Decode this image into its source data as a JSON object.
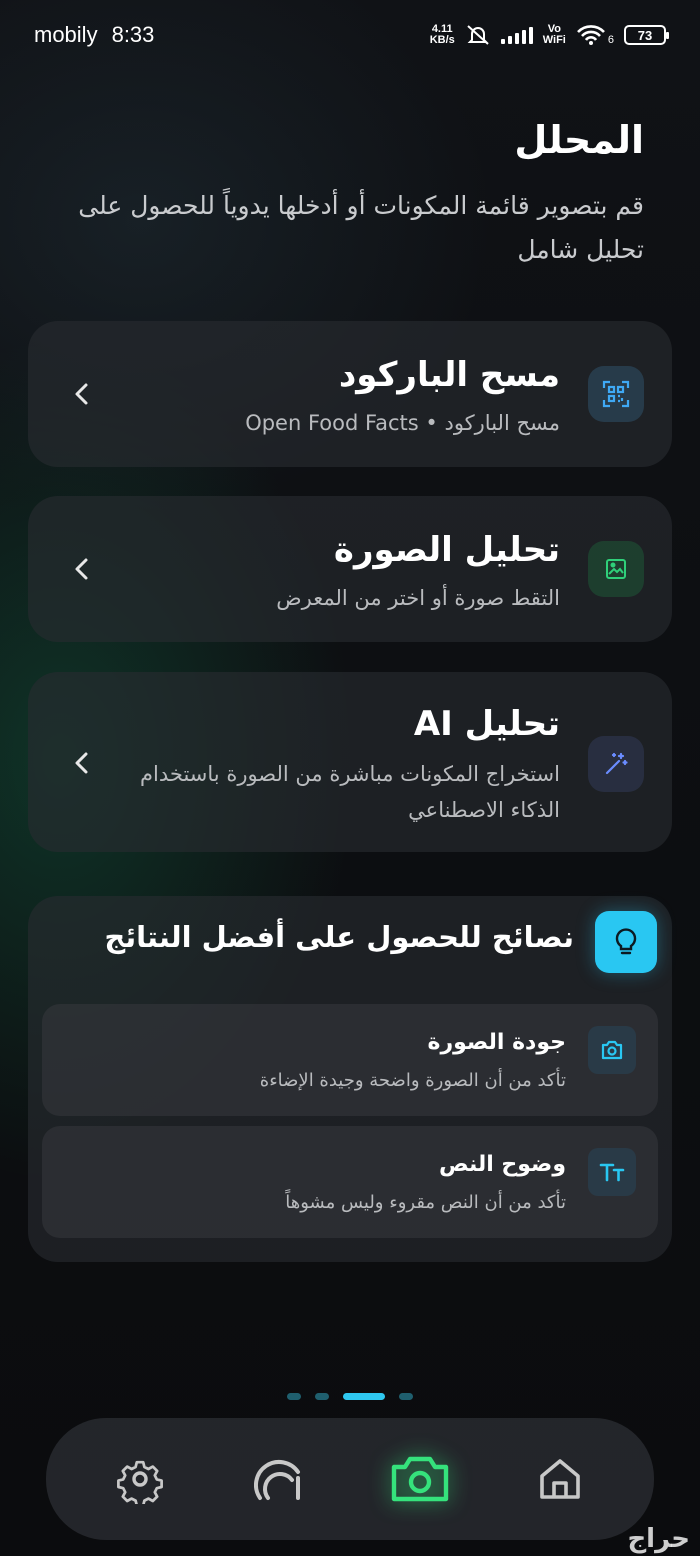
{
  "status_bar": {
    "carrier": "mobily",
    "time": "8:33",
    "net_speed_value": "4.11",
    "net_speed_unit": "KB/s",
    "vowifi_top": "Vo",
    "vowifi_bottom": "WiFi",
    "wifi_number": "6",
    "battery": "73"
  },
  "header": {
    "title": "المحلل",
    "subtitle": "قم بتصوير قائمة المكونات أو أدخلها يدوياً للحصول على تحليل شامل"
  },
  "options": [
    {
      "title": "مسح الباركود",
      "subtitle": "مسح الباركود • Open Food Facts",
      "icon": "qr-scan-icon",
      "accent": "#3fa9f5"
    },
    {
      "title": "تحليل الصورة",
      "subtitle": "التقط صورة أو اختر من المعرض",
      "icon": "image-icon",
      "accent": "#2fd07a"
    },
    {
      "title": "تحليل AI",
      "subtitle": "استخراج المكونات مباشرة من الصورة باستخدام الذكاء الاصطناعي",
      "icon": "magic-wand-icon",
      "accent": "#6a8cff"
    }
  ],
  "tips": {
    "title": "نصائح للحصول على أفضل النتائج",
    "items": [
      {
        "title": "جودة الصورة",
        "subtitle": "تأكد من أن الصورة واضحة وجيدة الإضاءة",
        "icon": "camera-icon"
      },
      {
        "title": "وضوح النص",
        "subtitle": "تأكد من أن النص مقروء وليس مشوهاً",
        "icon": "text-size-icon"
      }
    ]
  },
  "pager": {
    "count": 4,
    "active_index": 2
  },
  "nav": [
    {
      "name": "settings",
      "icon": "gear-icon"
    },
    {
      "name": "gauge",
      "icon": "gauge-icon"
    },
    {
      "name": "camera",
      "icon": "camera-icon",
      "active": true
    },
    {
      "name": "home",
      "icon": "home-icon"
    }
  ],
  "colors": {
    "accent_cyan": "#29c7f2",
    "accent_green": "#2fe07a",
    "card_bg": "#282b30"
  },
  "watermark": "حراج"
}
